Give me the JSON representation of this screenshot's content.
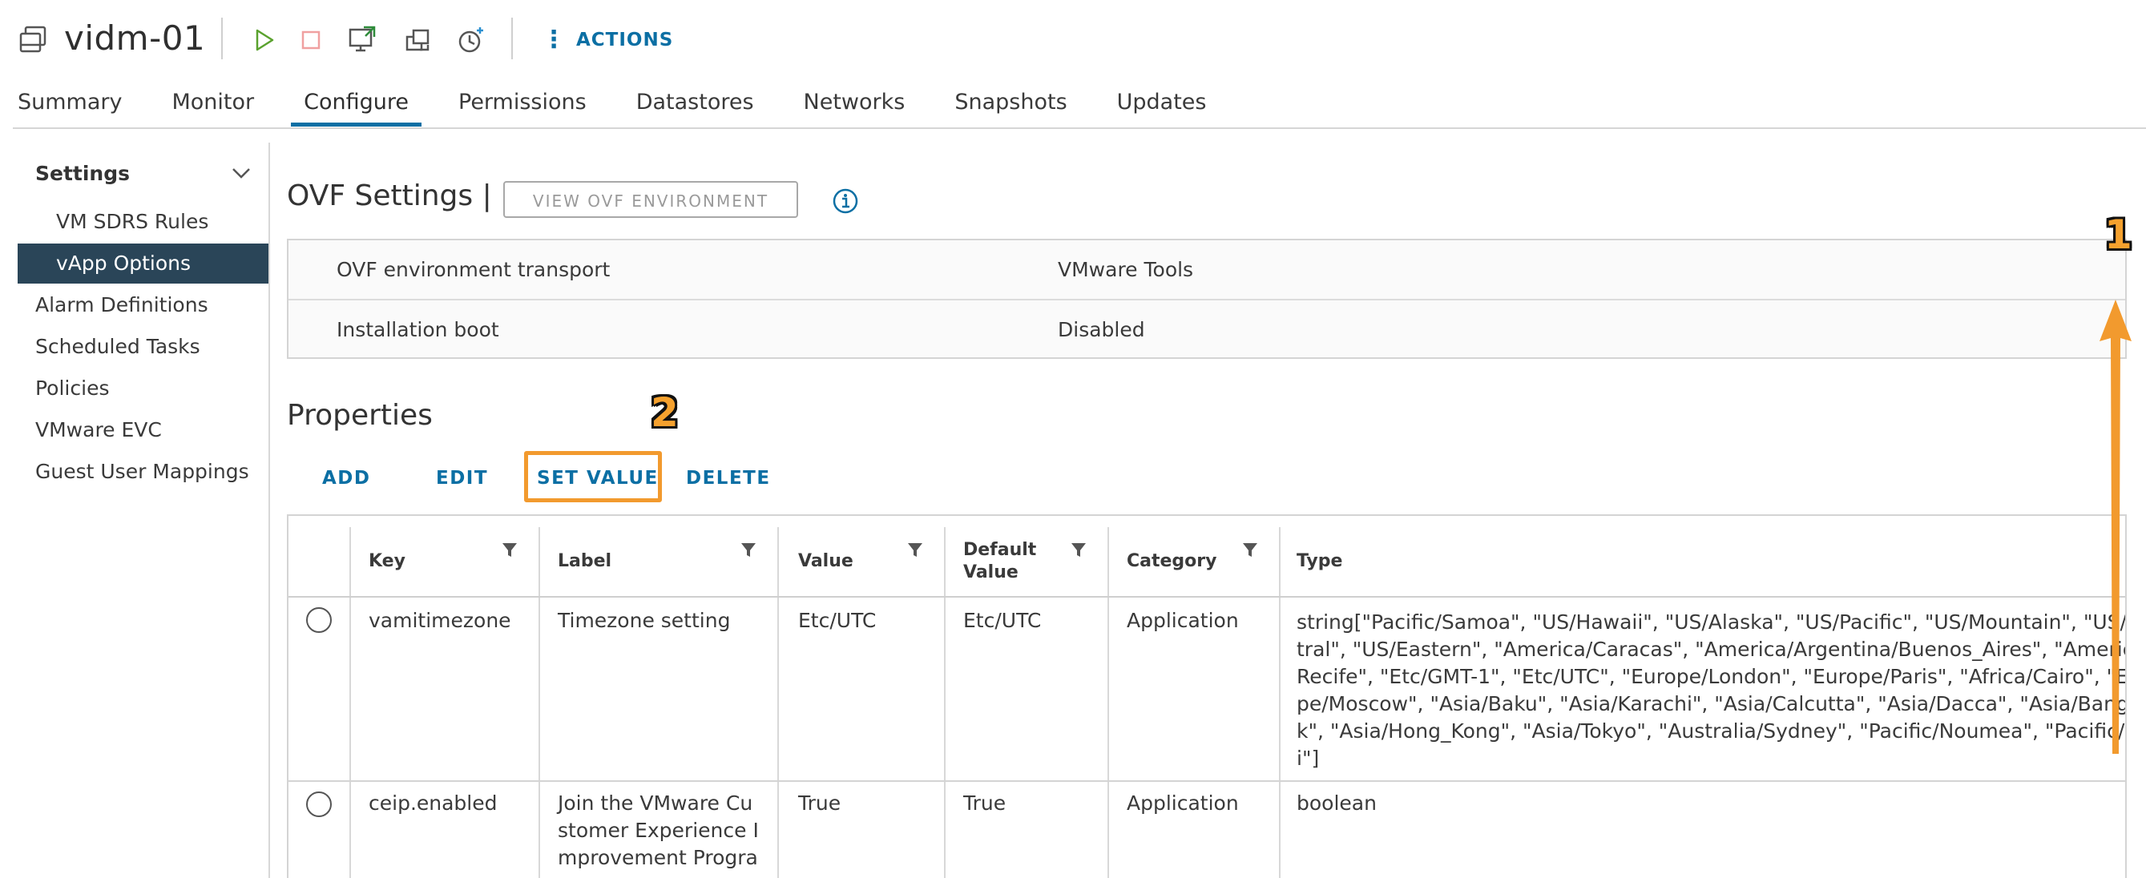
{
  "header": {
    "title": "vidm-01",
    "actions_label": "ACTIONS"
  },
  "tabs": [
    {
      "label": "Summary"
    },
    {
      "label": "Monitor"
    },
    {
      "label": "Configure"
    },
    {
      "label": "Permissions"
    },
    {
      "label": "Datastores"
    },
    {
      "label": "Networks"
    },
    {
      "label": "Snapshots"
    },
    {
      "label": "Updates"
    }
  ],
  "sidebar": {
    "section_title": "Settings",
    "items": [
      {
        "label": "VM SDRS Rules"
      },
      {
        "label": "vApp Options"
      },
      {
        "label": "Alarm Definitions"
      },
      {
        "label": "Scheduled Tasks"
      },
      {
        "label": "Policies"
      },
      {
        "label": "VMware EVC"
      },
      {
        "label": "Guest User Mappings"
      }
    ]
  },
  "ovf": {
    "title": "OVF Settings |",
    "view_button": "VIEW OVF ENVIRONMENT",
    "rows": [
      {
        "key": "OVF environment transport",
        "value": "VMware Tools"
      },
      {
        "key": "Installation boot",
        "value": "Disabled"
      }
    ]
  },
  "properties": {
    "title": "Properties",
    "buttons": {
      "add": "ADD",
      "edit": "EDIT",
      "set_value": "SET VALUE",
      "delete": "DELETE"
    },
    "columns": {
      "key": "Key",
      "label": "Label",
      "value": "Value",
      "default_value_1": "Default",
      "default_value_2": "Value",
      "category": "Category",
      "type": "Type"
    },
    "rows": [
      {
        "key": "vamitimezone",
        "label": "Timezone setting",
        "value": "Etc/UTC",
        "default": "Etc/UTC",
        "category": "Application",
        "type": "string[\"Pacific/Samoa\", \"US/Hawaii\", \"US/Alaska\", \"US/Pacific\", \"US/Mountain\", \"US/Central\",\ntral\", \"US/Eastern\", \"America/Caracas\", \"America/Argentina/Buenos_Aires\", \"America/\nRecife\", \"Etc/GMT-1\", \"Etc/UTC\", \"Europe/London\", \"Europe/Paris\", \"Africa/Cairo\", \"Euro\npe/Moscow\", \"Asia/Baku\", \"Asia/Karachi\", \"Asia/Calcutta\", \"Asia/Dacca\", \"Asia/Bangko\nk\", \"Asia/Hong_Kong\", \"Asia/Tokyo\", \"Australia/Sydney\", \"Pacific/Noumea\", \"Pacific/Fij\ni\"]"
      },
      {
        "key": "ceip.enabled",
        "label_lines": [
          "Join the VMware Cu",
          "stomer Experience I",
          "mprovement Progra"
        ],
        "value": "True",
        "default": "True",
        "category": "Application",
        "type": "boolean"
      }
    ]
  },
  "annotations": {
    "badge_1": "1",
    "badge_2": "2",
    "accent_color": "#f29a2e"
  },
  "colors": {
    "link_blue": "#0b6fa4",
    "nav_active_bg": "#2a4558"
  }
}
